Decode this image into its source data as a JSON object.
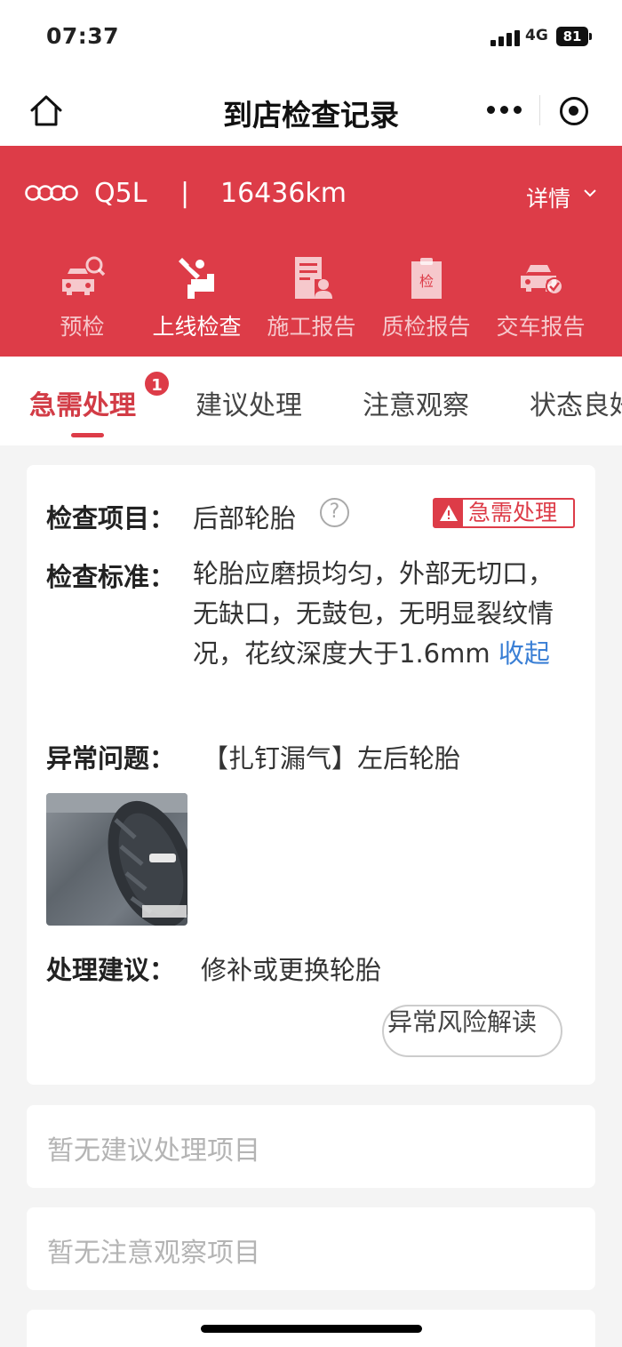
{
  "status_bar": {
    "time": "07:37",
    "network": "4G",
    "battery": "81"
  },
  "nav": {
    "title": "到店检查记录"
  },
  "vehicle": {
    "model": "Q5L",
    "separator": "|",
    "mileage": "16436km",
    "detail_label": "详情"
  },
  "steps": [
    {
      "label": "预检",
      "icon": "car-search-icon",
      "active": false
    },
    {
      "label": "上线检查",
      "icon": "wrench-tool-icon",
      "active": true
    },
    {
      "label": "施工报告",
      "icon": "worker-report-icon",
      "active": false
    },
    {
      "label": "质检报告",
      "icon": "clipboard-check-icon",
      "active": false
    },
    {
      "label": "交车报告",
      "icon": "car-check-icon",
      "active": false
    }
  ],
  "tabs": [
    {
      "label": "急需处理",
      "badge": "1",
      "active": true
    },
    {
      "label": "建议处理"
    },
    {
      "label": "注意观察"
    },
    {
      "label": "状态良好"
    }
  ],
  "item": {
    "label_item": "检查项目：",
    "name": "后部轮胎",
    "urgent_tag": "急需处理",
    "label_standard": "检查标准：",
    "standard": "轮胎应磨损均匀，外部无切口，无缺口，无鼓包，无明显裂纹情况，花纹深度大于1.6mm",
    "collapse_label": "收起",
    "label_problem": "异常问题：",
    "problem": "【扎钉漏气】左后轮胎",
    "label_advice": "处理建议：",
    "advice": "修补或更换轮胎",
    "risk_button": "异常风险解读"
  },
  "empty_suggest": "暂无建议处理项目",
  "empty_observe": "暂无注意观察项目",
  "colors": {
    "primary_red": "#dd3c48",
    "link_blue": "#3a7fd5"
  }
}
